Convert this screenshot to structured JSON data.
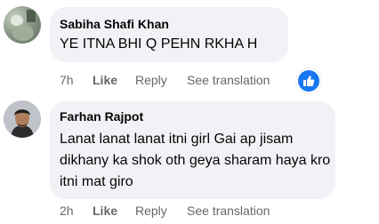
{
  "comments": [
    {
      "author": "Sabiha Shafi Khan",
      "text": "YE ITNA BHI Q PEHN RKHA H",
      "time": "7h",
      "like_label": "Like",
      "reply_label": "Reply",
      "translate_label": "See translation",
      "reaction_icon": "like-thumb-icon"
    },
    {
      "author": "Farhan Rajpot",
      "text": "Lanat lanat lanat itni girl Gai ap jisam dikhany ka shok oth geya sharam haya kro itni mat giro",
      "time": "2h",
      "like_label": "Like",
      "reply_label": "Reply",
      "translate_label": "See translation"
    }
  ],
  "colors": {
    "accent": "#1877f2",
    "bubble": "#f0f2f5",
    "meta": "#65676b"
  }
}
